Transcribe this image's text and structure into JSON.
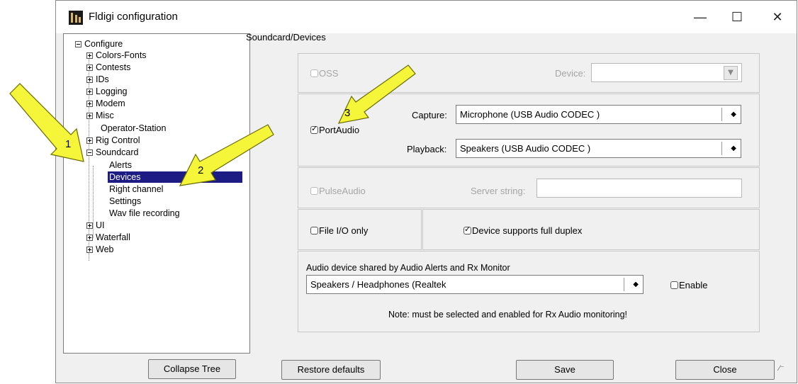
{
  "window": {
    "title": "Fldigi configuration",
    "minimize": "—",
    "maximize": "☐",
    "close": "✕"
  },
  "tree": {
    "root": "Configure",
    "items": {
      "colors": "Colors-Fonts",
      "contests": "Contests",
      "ids": "IDs",
      "logging": "Logging",
      "modem": "Modem",
      "misc": "Misc",
      "operator": "Operator-Station",
      "rig": "Rig Control",
      "soundcard": "Soundcard",
      "alerts": "Alerts",
      "devices": "Devices",
      "right_channel": "Right channel",
      "settings": "Settings",
      "wav": "Wav file recording",
      "ui": "UI",
      "waterfall": "Waterfall",
      "web": "Web"
    },
    "selected": "Devices"
  },
  "panel_title": "Soundcard/Devices",
  "oss": {
    "label": "OSS",
    "device_label": "Device:",
    "device_value": ""
  },
  "portaudio": {
    "label": "PortAudio",
    "checked": true,
    "capture_label": "Capture:",
    "capture_value": "Microphone (USB Audio CODEC )",
    "playback_label": "Playback:",
    "playback_value": "Speakers (USB Audio CODEC )"
  },
  "pulseaudio": {
    "label": "PulseAudio",
    "server_label": "Server string:",
    "server_value": ""
  },
  "fileio": {
    "label": "File I/O only"
  },
  "duplex": {
    "label": "Device supports full duplex",
    "checked": true
  },
  "shared": {
    "label": "Audio device shared by Audio Alerts and Rx Monitor",
    "value": "Speakers / Headphones (Realtek",
    "enable_label": "Enable",
    "note": "Note: must be selected and enabled for Rx Audio monitoring!"
  },
  "buttons": {
    "collapse": "Collapse Tree",
    "restore": "Restore defaults",
    "save": "Save",
    "close": "Close"
  },
  "annotations": {
    "arrow1": "1",
    "arrow2": "2",
    "arrow3": "3"
  },
  "colors": {
    "selection": "#1c1c84",
    "arrow_fill": "#f5f53a",
    "arrow_stroke": "#6b6b00"
  }
}
